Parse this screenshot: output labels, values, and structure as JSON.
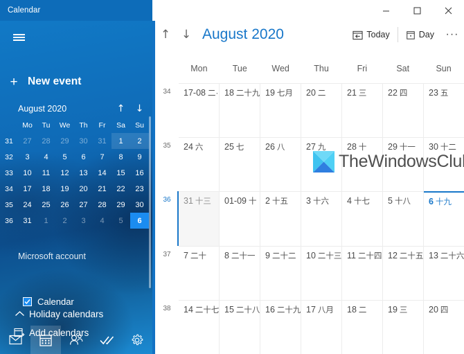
{
  "window": {
    "title": "Calendar",
    "controls": {
      "minimize": "minimize-icon",
      "maximize": "maximize-icon",
      "close": "close-icon"
    }
  },
  "sidebar": {
    "hamburger": "hamburger-icon",
    "new_event": {
      "label": "New event",
      "icon": "plus-icon"
    },
    "mini_calendar": {
      "month_label": "August 2020",
      "prev_icon": "↑",
      "next_icon": "↓",
      "dow": [
        "Mo",
        "Tu",
        "We",
        "Th",
        "Fr",
        "Sa",
        "Su"
      ],
      "weeks": [
        {
          "wk": "31",
          "days": [
            {
              "d": "27",
              "state": "dim"
            },
            {
              "d": "28",
              "state": "dim"
            },
            {
              "d": "29",
              "state": "dim"
            },
            {
              "d": "30",
              "state": "dim"
            },
            {
              "d": "31",
              "state": "dim"
            },
            {
              "d": "1",
              "state": "hl"
            },
            {
              "d": "2",
              "state": "hl"
            }
          ]
        },
        {
          "wk": "32",
          "days": [
            {
              "d": "3",
              "state": ""
            },
            {
              "d": "4",
              "state": ""
            },
            {
              "d": "5",
              "state": ""
            },
            {
              "d": "6",
              "state": ""
            },
            {
              "d": "7",
              "state": ""
            },
            {
              "d": "8",
              "state": ""
            },
            {
              "d": "9",
              "state": ""
            }
          ]
        },
        {
          "wk": "33",
          "days": [
            {
              "d": "10",
              "state": ""
            },
            {
              "d": "11",
              "state": ""
            },
            {
              "d": "12",
              "state": ""
            },
            {
              "d": "13",
              "state": ""
            },
            {
              "d": "14",
              "state": ""
            },
            {
              "d": "15",
              "state": ""
            },
            {
              "d": "16",
              "state": ""
            }
          ]
        },
        {
          "wk": "34",
          "days": [
            {
              "d": "17",
              "state": ""
            },
            {
              "d": "18",
              "state": ""
            },
            {
              "d": "19",
              "state": ""
            },
            {
              "d": "20",
              "state": ""
            },
            {
              "d": "21",
              "state": ""
            },
            {
              "d": "22",
              "state": ""
            },
            {
              "d": "23",
              "state": ""
            }
          ]
        },
        {
          "wk": "35",
          "days": [
            {
              "d": "24",
              "state": ""
            },
            {
              "d": "25",
              "state": ""
            },
            {
              "d": "26",
              "state": ""
            },
            {
              "d": "27",
              "state": ""
            },
            {
              "d": "28",
              "state": ""
            },
            {
              "d": "29",
              "state": ""
            },
            {
              "d": "30",
              "state": ""
            }
          ]
        },
        {
          "wk": "36",
          "days": [
            {
              "d": "31",
              "state": ""
            },
            {
              "d": "1",
              "state": "dim"
            },
            {
              "d": "2",
              "state": "dim"
            },
            {
              "d": "3",
              "state": "dim"
            },
            {
              "d": "4",
              "state": "dim"
            },
            {
              "d": "5",
              "state": "dim"
            },
            {
              "d": "6",
              "state": "today"
            }
          ]
        }
      ]
    },
    "account_label": "Microsoft account",
    "calendar_item": {
      "label": "Calendar",
      "checked": true
    },
    "holiday_calendars": {
      "label": "Holiday calendars",
      "icon": "chevron-up-icon"
    },
    "add_calendars": {
      "label": "Add calendars",
      "icon": "calendar-add-icon"
    },
    "bottom_nav": [
      {
        "name": "mail-icon",
        "active": false
      },
      {
        "name": "calendar-icon",
        "active": true
      },
      {
        "name": "people-icon",
        "active": false
      },
      {
        "name": "todo-icon",
        "active": false
      },
      {
        "name": "settings-gear-icon",
        "active": false
      }
    ]
  },
  "main": {
    "toolbar": {
      "prev_icon": "↑",
      "next_icon": "↓",
      "title": "August 2020",
      "today_label": "Today",
      "today_icon": "today-calendar-icon",
      "view_label": "Day",
      "view_icon": "day-view-icon",
      "more_label": "···"
    },
    "day_headers": [
      "Mon",
      "Tue",
      "Wed",
      "Thu",
      "Fri",
      "Sat",
      "Sun"
    ],
    "weeks": [
      {
        "wk": "34",
        "current": false,
        "days": [
          {
            "num": "17-08",
            "lunar": "二·",
            "other": false,
            "today": false
          },
          {
            "num": "18",
            "lunar": "二十九",
            "other": false,
            "today": false
          },
          {
            "num": "19",
            "lunar": "七月",
            "other": false,
            "today": false
          },
          {
            "num": "20",
            "lunar": "二",
            "other": false,
            "today": false
          },
          {
            "num": "21",
            "lunar": "三",
            "other": false,
            "today": false
          },
          {
            "num": "22",
            "lunar": "四",
            "other": false,
            "today": false
          },
          {
            "num": "23",
            "lunar": "五",
            "other": false,
            "today": false
          }
        ]
      },
      {
        "wk": "35",
        "current": false,
        "days": [
          {
            "num": "24",
            "lunar": "六",
            "other": false,
            "today": false
          },
          {
            "num": "25",
            "lunar": "七",
            "other": false,
            "today": false
          },
          {
            "num": "26",
            "lunar": "八",
            "other": false,
            "today": false
          },
          {
            "num": "27",
            "lunar": "九",
            "other": false,
            "today": false
          },
          {
            "num": "28",
            "lunar": "十",
            "other": false,
            "today": false
          },
          {
            "num": "29",
            "lunar": "十一",
            "other": false,
            "today": false
          },
          {
            "num": "30",
            "lunar": "十二",
            "other": false,
            "today": false
          }
        ]
      },
      {
        "wk": "36",
        "current": true,
        "days": [
          {
            "num": "31",
            "lunar": "十三",
            "other": true,
            "today": false
          },
          {
            "num": "01-09",
            "lunar": "十",
            "other": false,
            "today": false
          },
          {
            "num": "2",
            "lunar": "十五",
            "other": false,
            "today": false
          },
          {
            "num": "3",
            "lunar": "十六",
            "other": false,
            "today": false
          },
          {
            "num": "4",
            "lunar": "十七",
            "other": false,
            "today": false
          },
          {
            "num": "5",
            "lunar": "十八",
            "other": false,
            "today": false
          },
          {
            "num": "6",
            "lunar": "十九",
            "other": false,
            "today": true
          }
        ]
      },
      {
        "wk": "37",
        "current": false,
        "days": [
          {
            "num": "7",
            "lunar": "二十",
            "other": false,
            "today": false
          },
          {
            "num": "8",
            "lunar": "二十一",
            "other": false,
            "today": false
          },
          {
            "num": "9",
            "lunar": "二十二",
            "other": false,
            "today": false
          },
          {
            "num": "10",
            "lunar": "二十三",
            "other": false,
            "today": false
          },
          {
            "num": "11",
            "lunar": "二十四",
            "other": false,
            "today": false
          },
          {
            "num": "12",
            "lunar": "二十五",
            "other": false,
            "today": false
          },
          {
            "num": "13",
            "lunar": "二十六",
            "other": false,
            "today": false
          }
        ]
      },
      {
        "wk": "38",
        "current": false,
        "days": [
          {
            "num": "14",
            "lunar": "二十七",
            "other": false,
            "today": false
          },
          {
            "num": "15",
            "lunar": "二十八",
            "other": false,
            "today": false
          },
          {
            "num": "16",
            "lunar": "二十九",
            "other": false,
            "today": false
          },
          {
            "num": "17",
            "lunar": "八月",
            "other": false,
            "today": false
          },
          {
            "num": "18",
            "lunar": "二",
            "other": false,
            "today": false
          },
          {
            "num": "19",
            "lunar": "三",
            "other": false,
            "today": false
          },
          {
            "num": "20",
            "lunar": "四",
            "other": false,
            "today": false
          }
        ]
      }
    ]
  },
  "watermark": {
    "text": "TheWindowsClub",
    "logo": "thewindowsclub-logo"
  },
  "colors": {
    "sidebar_blue": "#0f6cba",
    "accent_blue": "#1877c9",
    "today_blue": "#1b8cf0",
    "titlebar_blue": "#0d6cb9"
  }
}
